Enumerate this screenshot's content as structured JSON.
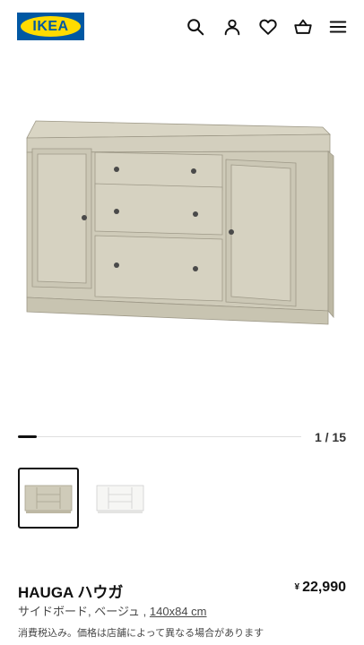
{
  "header": {
    "logo_text": "IKEA",
    "icons": [
      "search-icon",
      "account-icon",
      "heart-icon",
      "basket-icon",
      "menu-icon"
    ]
  },
  "gallery": {
    "current": 1,
    "total": 15,
    "counter_text": "1 / 15",
    "progress_fraction": 0.0667,
    "colors": {
      "furniture": "#cfcbb9",
      "furniture_shadow": "#bdb8a4",
      "accent": "#111111"
    }
  },
  "thumbnails": [
    {
      "name": "beige",
      "selected": true
    },
    {
      "name": "white",
      "selected": false
    }
  ],
  "product": {
    "name": "HAUGA ハウガ",
    "type_color": "サイドボード, ベージュ ,",
    "size": "140x84 cm",
    "currency": "¥",
    "price": "22,990",
    "tax_note": "消費税込み。価格は店舗によって異なる場合があります"
  }
}
